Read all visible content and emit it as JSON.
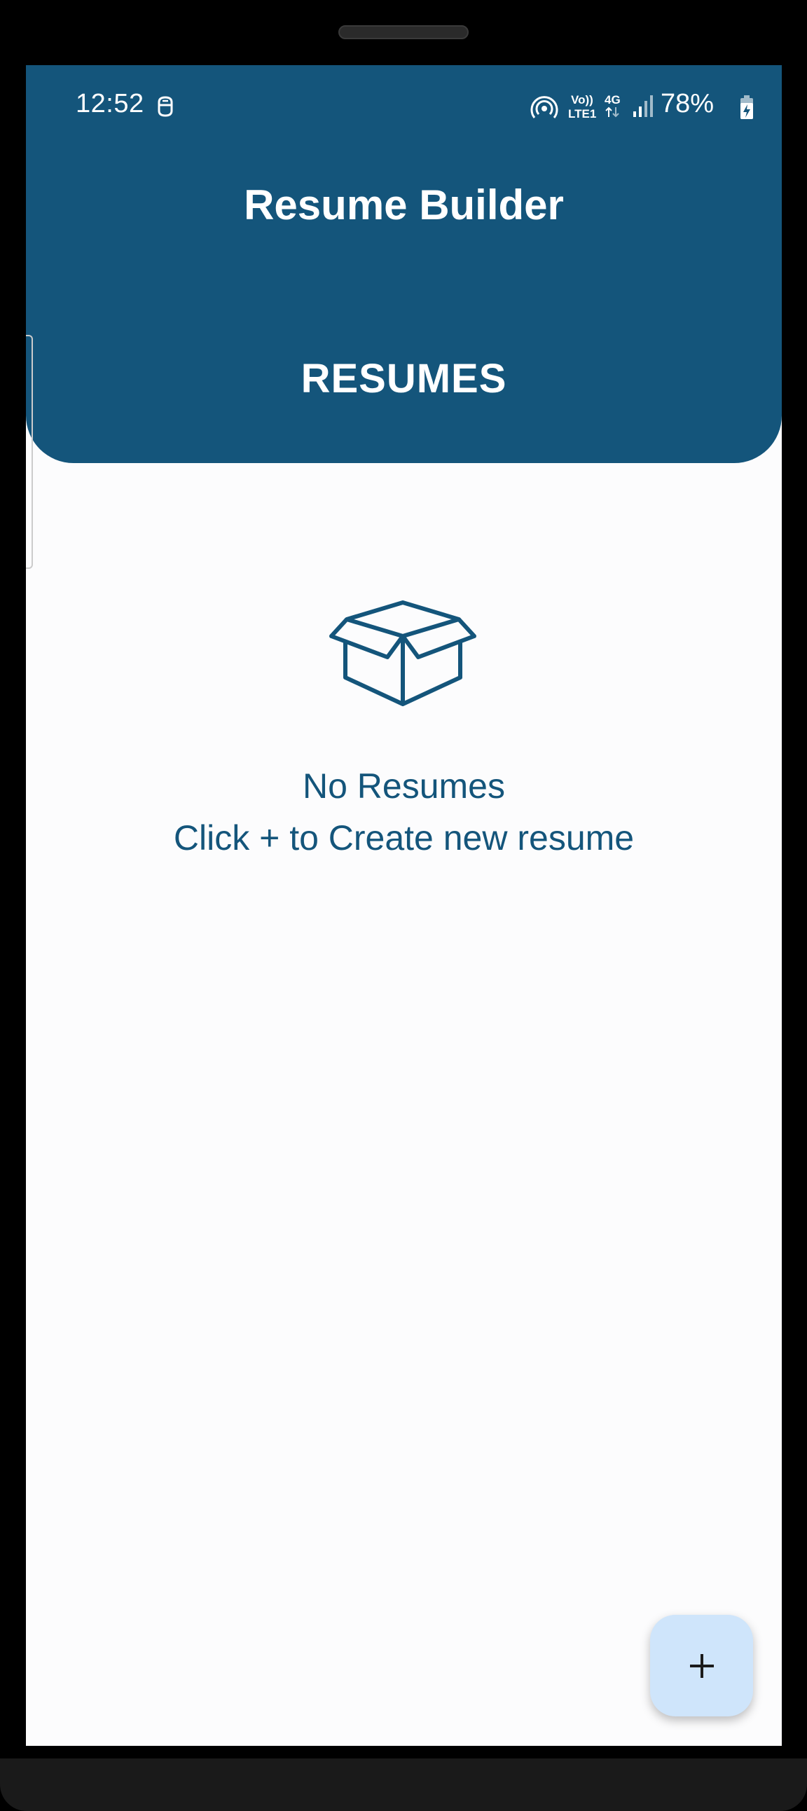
{
  "status_bar": {
    "time": "12:52",
    "battery": "78%",
    "network_volte": "Vo))",
    "network_lte": "LTE1",
    "network_type": "4G"
  },
  "app_bar": {
    "title": "Resume Builder",
    "section": "RESUMES"
  },
  "empty_state": {
    "icon": "open-box-icon",
    "line1": "No Resumes",
    "line2": "Click + to Create new resume"
  },
  "fab": {
    "icon": "plus-icon"
  },
  "colors": {
    "primary": "#14557b",
    "background": "#fcfcfd",
    "fab": "#cfe5fb"
  }
}
